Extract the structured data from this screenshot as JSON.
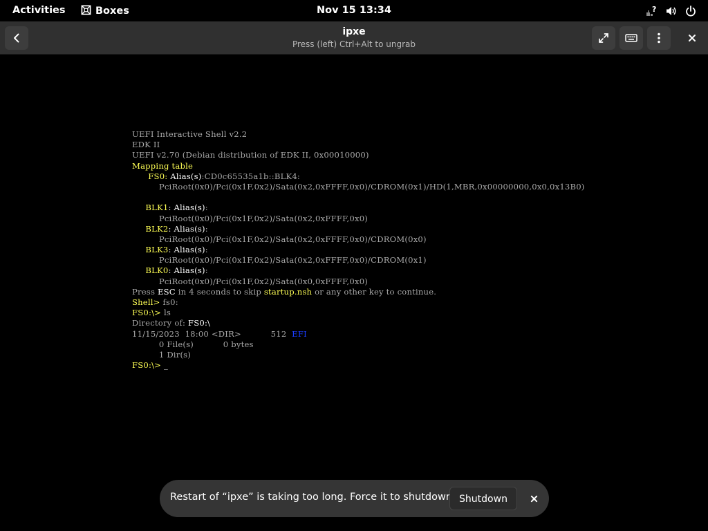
{
  "topbar": {
    "activities": "Activities",
    "app_name": "Boxes",
    "app_icon": "boxes-icon",
    "clock": "Nov 15  13:34",
    "status_icons": [
      "network-unknown-icon",
      "volume-icon",
      "power-icon"
    ]
  },
  "header": {
    "title": "ipxe",
    "subtitle": "Press (left) Ctrl+Alt to ungrab",
    "buttons": [
      "back-icon",
      "fullscreen-icon",
      "keyboard-icon",
      "menu-icon",
      "close-icon"
    ]
  },
  "console": {
    "lines": [
      [
        {
          "t": "UEFI Interactive Shell v2.2"
        }
      ],
      [
        {
          "t": "EDK II"
        }
      ],
      [
        {
          "t": "UEFI v2.70 (Debian distribution of EDK II, 0x00010000)"
        }
      ],
      [
        {
          "t": "Mapping table",
          "c": "y"
        }
      ],
      [
        {
          "t": "      FS0",
          "c": "y"
        },
        {
          "t": ": ",
          "c": "y"
        },
        {
          "t": "Alias(s)",
          "c": "w"
        },
        {
          "t": ":CD0c65535a1b::BLK4:"
        }
      ],
      [
        {
          "t": "          PciRoot(0x0)/Pci(0x1F,0x2)/Sata(0x2,0xFFFF,0x0)/CDROM(0x1)/HD(1,MBR,0x00000000,0x0,0x13B0)"
        }
      ],
      [
        {
          "t": ""
        }
      ],
      [
        {
          "t": "     BLK1",
          "c": "y"
        },
        {
          "t": ": ",
          "c": "w"
        },
        {
          "t": "Alias(s)",
          "c": "w"
        },
        {
          "t": ":"
        }
      ],
      [
        {
          "t": "          PciRoot(0x0)/Pci(0x1F,0x2)/Sata(0x2,0xFFFF,0x0)"
        }
      ],
      [
        {
          "t": "     BLK2",
          "c": "y"
        },
        {
          "t": ": ",
          "c": "w"
        },
        {
          "t": "Alias(s)",
          "c": "w"
        },
        {
          "t": ":"
        }
      ],
      [
        {
          "t": "          PciRoot(0x0)/Pci(0x1F,0x2)/Sata(0x2,0xFFFF,0x0)/CDROM(0x0)"
        }
      ],
      [
        {
          "t": "     BLK3",
          "c": "y"
        },
        {
          "t": ": ",
          "c": "w"
        },
        {
          "t": "Alias(s)",
          "c": "w"
        },
        {
          "t": ":"
        }
      ],
      [
        {
          "t": "          PciRoot(0x0)/Pci(0x1F,0x2)/Sata(0x2,0xFFFF,0x0)/CDROM(0x1)"
        }
      ],
      [
        {
          "t": "     BLK0",
          "c": "y"
        },
        {
          "t": ": ",
          "c": "w"
        },
        {
          "t": "Alias(s)",
          "c": "w"
        },
        {
          "t": ":"
        }
      ],
      [
        {
          "t": "          PciRoot(0x0)/Pci(0x1F,0x2)/Sata(0x0,0xFFFF,0x0)"
        }
      ],
      [
        {
          "t": "Press "
        },
        {
          "t": "ESC",
          "c": "w"
        },
        {
          "t": " in 4 seconds to skip "
        },
        {
          "t": "startup.nsh",
          "c": "y"
        },
        {
          "t": " or any other key to continue."
        }
      ],
      [
        {
          "t": "Shell> ",
          "c": "y"
        },
        {
          "t": "fs0:"
        }
      ],
      [
        {
          "t": "FS0:\\> ",
          "c": "y"
        },
        {
          "t": "ls"
        }
      ],
      [
        {
          "t": "Directory of: "
        },
        {
          "t": "FS0:\\",
          "c": "w"
        }
      ],
      [
        {
          "t": "11/15/2023  18:00 <DIR>           512  "
        },
        {
          "t": "EFI",
          "c": "b"
        }
      ],
      [
        {
          "t": "          0 File(s)           0 bytes"
        }
      ],
      [
        {
          "t": "          1 Dir(s)"
        }
      ],
      [
        {
          "t": "FS0:\\> ",
          "c": "y"
        },
        {
          "t": "_",
          "c": "w"
        }
      ]
    ]
  },
  "toast": {
    "message": "Restart of “ipxe” is taking too long. Force it to shutdown?",
    "action_label": "Shutdown",
    "close_icon": "close-icon"
  },
  "colors": {
    "topbar_bg": "#000000",
    "headerbar_bg": "#303030",
    "console_text": "#a9a9a9",
    "console_highlight": "#ffff55",
    "console_bright": "#ffffff",
    "console_dir": "#1a3cff",
    "toast_bg": "#353535"
  }
}
